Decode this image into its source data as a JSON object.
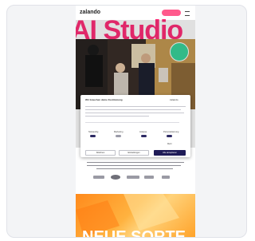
{
  "header": {
    "logo": "zalando",
    "pill_label": "",
    "menu_icon": "hamburger-icon"
  },
  "hero": {
    "title": "AI Studio",
    "sticker_icon": "sticker-badge-icon"
  },
  "cookie_dialog": {
    "title": "Wir brauchen deine Zustimmung",
    "logo": "zalando",
    "toggles": [
      {
        "label": "Notwendig",
        "state": "on"
      },
      {
        "label": "Marketing",
        "state": "off"
      },
      {
        "label": "Analyse",
        "state": "on"
      },
      {
        "label": "Personalisierung",
        "state": "on"
      }
    ],
    "more_link": "Mehr",
    "buttons": [
      "Ablehnen",
      "Einstellungen",
      "Alle akzeptieren"
    ]
  },
  "promo": {
    "title": "NEUE SORTE"
  },
  "colors": {
    "brand_pink": "#ff2d78",
    "dialog_accent": "#1f1b57",
    "promo_orange": "#ff8a1c",
    "sticker_green": "#39d49b"
  }
}
